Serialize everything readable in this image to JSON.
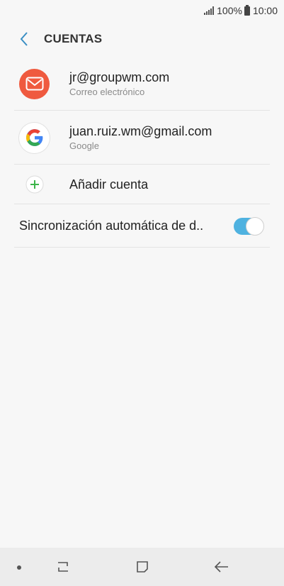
{
  "status_bar": {
    "battery": "100%",
    "time": "10:00"
  },
  "header": {
    "title": "CUENTAS"
  },
  "accounts": [
    {
      "primary": "jr@groupwm.com",
      "secondary": "Correo electrónico",
      "icon": "email-icon"
    },
    {
      "primary": "juan.ruiz.wm@gmail.com",
      "secondary": "Google",
      "icon": "google-icon"
    }
  ],
  "add_account": {
    "label": "Añadir cuenta",
    "icon": "plus-icon"
  },
  "sync": {
    "label": "Sincronización automática de d..",
    "enabled": true
  },
  "colors": {
    "accent": "#4fb2e0",
    "email_icon_bg": "#ef5a3f",
    "plus_green": "#3cb54a",
    "back_arrow": "#3b8fc4"
  },
  "nav_bar": {
    "items": [
      "dot",
      "recents",
      "home",
      "back"
    ]
  }
}
